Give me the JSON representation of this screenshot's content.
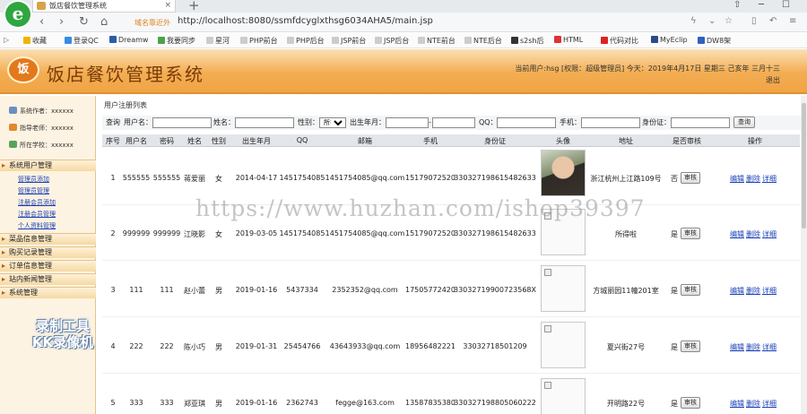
{
  "browser": {
    "tab_title": "饭店餐饮管理系统",
    "tab_close": "×",
    "new_tab": "+",
    "logo": "e",
    "safe_tag": "域名靠近外",
    "url": "http://localhost:8080/ssmfdcyglxthsg6034AHA5/main.jsp",
    "bookmarks": [
      "收藏",
      "登录QC",
      "Dreamw",
      "我要同步",
      "星河",
      "PHP前台",
      "PHP后台",
      "JSP前台",
      "JSP后台",
      "NTE前台",
      "NTE后台",
      "s2sh后",
      "HTML",
      "代码对比",
      "MyEclip",
      "DW8架"
    ]
  },
  "app": {
    "logo": "饭",
    "title": "饭店餐饮管理系统",
    "info_line1": "当前用户:hsg [权限：超级管理员] 今天：2019年4月17日 星期三 己亥年 三月十三",
    "info_line2": "退出"
  },
  "sidebar": {
    "info": [
      {
        "label": "系统作者：xxxxxx"
      },
      {
        "label": "指导老师：xxxxxx"
      },
      {
        "label": "所在学校：xxxxxx"
      }
    ],
    "groups": [
      {
        "label": "系统用户管理",
        "items": [
          "管理员添加",
          "管理员管理",
          "注册会员添加",
          "注册会员管理",
          "个人资料管理"
        ]
      },
      {
        "label": "菜品信息管理",
        "items": []
      },
      {
        "label": "购买记录管理",
        "items": []
      },
      {
        "label": "订单信息管理",
        "items": []
      },
      {
        "label": "站内新闻管理",
        "items": []
      },
      {
        "label": "系统管理",
        "items": []
      }
    ]
  },
  "main": {
    "breadcrumb": "用户注册列表",
    "query": {
      "prefix": "查询",
      "username_label": "用户名：",
      "name_label": "姓名：",
      "gender_label": "性别：",
      "gender_value": "所有",
      "birth_label": "出生年月：",
      "range_sep": "-",
      "qq_label": "QQ：",
      "phone_label": "手机：",
      "idcard_label": "身份证：",
      "button": "查询"
    },
    "columns": [
      "序号",
      "用户名",
      "密码",
      "姓名",
      "性别",
      "出生年月",
      "QQ",
      "邮箱",
      "手机",
      "身份证",
      "头像",
      "地址",
      "是否审核",
      "操作"
    ],
    "rows": [
      {
        "no": "1",
        "username": "555555",
        "password": "555555",
        "name": "蒋爱丽",
        "gender": "女",
        "birth": "2014-04-17",
        "qq": "1451754085",
        "email": "1451754085@qq.com",
        "phone": "15179072520",
        "idcard": "330327198615482633",
        "address": "浙江杭州上江路109号",
        "audited": "否",
        "audit_btn": "审核",
        "edit": "编辑",
        "delete": "删除",
        "detail": "详细"
      },
      {
        "no": "2",
        "username": "999999",
        "password": "999999",
        "name": "江晓影",
        "gender": "女",
        "birth": "2019-03-05",
        "qq": "1451754085",
        "email": "1451754085@qq.com",
        "phone": "15179072520",
        "idcard": "330327198615482633",
        "address": "所得啦",
        "audited": "是",
        "audit_btn": "审核",
        "edit": "编辑",
        "delete": "删除",
        "detail": "详细"
      },
      {
        "no": "3",
        "username": "111",
        "password": "111",
        "name": "赵小蕾",
        "gender": "男",
        "birth": "2019-01-16",
        "qq": "5437334",
        "email": "2352352@qq.com",
        "phone": "17505772420",
        "idcard": "33032719900723568X",
        "address": "方城丽园11幢201室",
        "audited": "是",
        "audit_btn": "审核",
        "edit": "编辑",
        "delete": "删除",
        "detail": "详细"
      },
      {
        "no": "4",
        "username": "222",
        "password": "222",
        "name": "陈小巧",
        "gender": "男",
        "birth": "2019-01-31",
        "qq": "25454766",
        "email": "43643933@qq.com",
        "phone": "18956482221",
        "idcard": "33032718501209",
        "address": "夏兴街27号",
        "audited": "是",
        "audit_btn": "审核",
        "edit": "编辑",
        "delete": "删除",
        "detail": "详细"
      },
      {
        "no": "5",
        "username": "333",
        "password": "333",
        "name": "郑亚琪",
        "gender": "男",
        "birth": "2019-01-16",
        "qq": "2362743",
        "email": "fegge@163.com",
        "phone": "13587835380",
        "idcard": "330327198805060222",
        "address": "开明路22号",
        "audited": "是",
        "audit_btn": "审核",
        "edit": "编辑",
        "delete": "删除",
        "detail": "详细"
      }
    ]
  },
  "overlay": {
    "watermark": "https://www.huzhan.com/ishop39397",
    "kk_line1": "录制工具",
    "kk_line2": "KK录像机"
  }
}
